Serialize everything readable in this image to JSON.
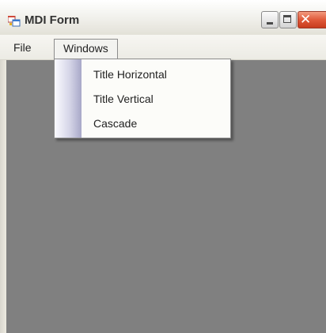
{
  "window": {
    "title": "MDI Form",
    "icon": "mdi-form-app-icon",
    "caption_buttons": {
      "minimize_icon": "minimize-icon",
      "maximize_icon": "maximize-icon",
      "close_icon": "close-icon",
      "close_glyph": "✕"
    }
  },
  "menubar": {
    "items": [
      {
        "label": "File"
      },
      {
        "label": "Windows"
      }
    ]
  },
  "windows_menu": {
    "open": true,
    "items": [
      {
        "label": "Title Horizontal"
      },
      {
        "label": "Title Vertical"
      },
      {
        "label": "Cascade"
      }
    ]
  },
  "colors": {
    "mdi_client_background": "#808080",
    "close_button": "#e05a3a",
    "menu_gutter": "#a8a8c8"
  }
}
